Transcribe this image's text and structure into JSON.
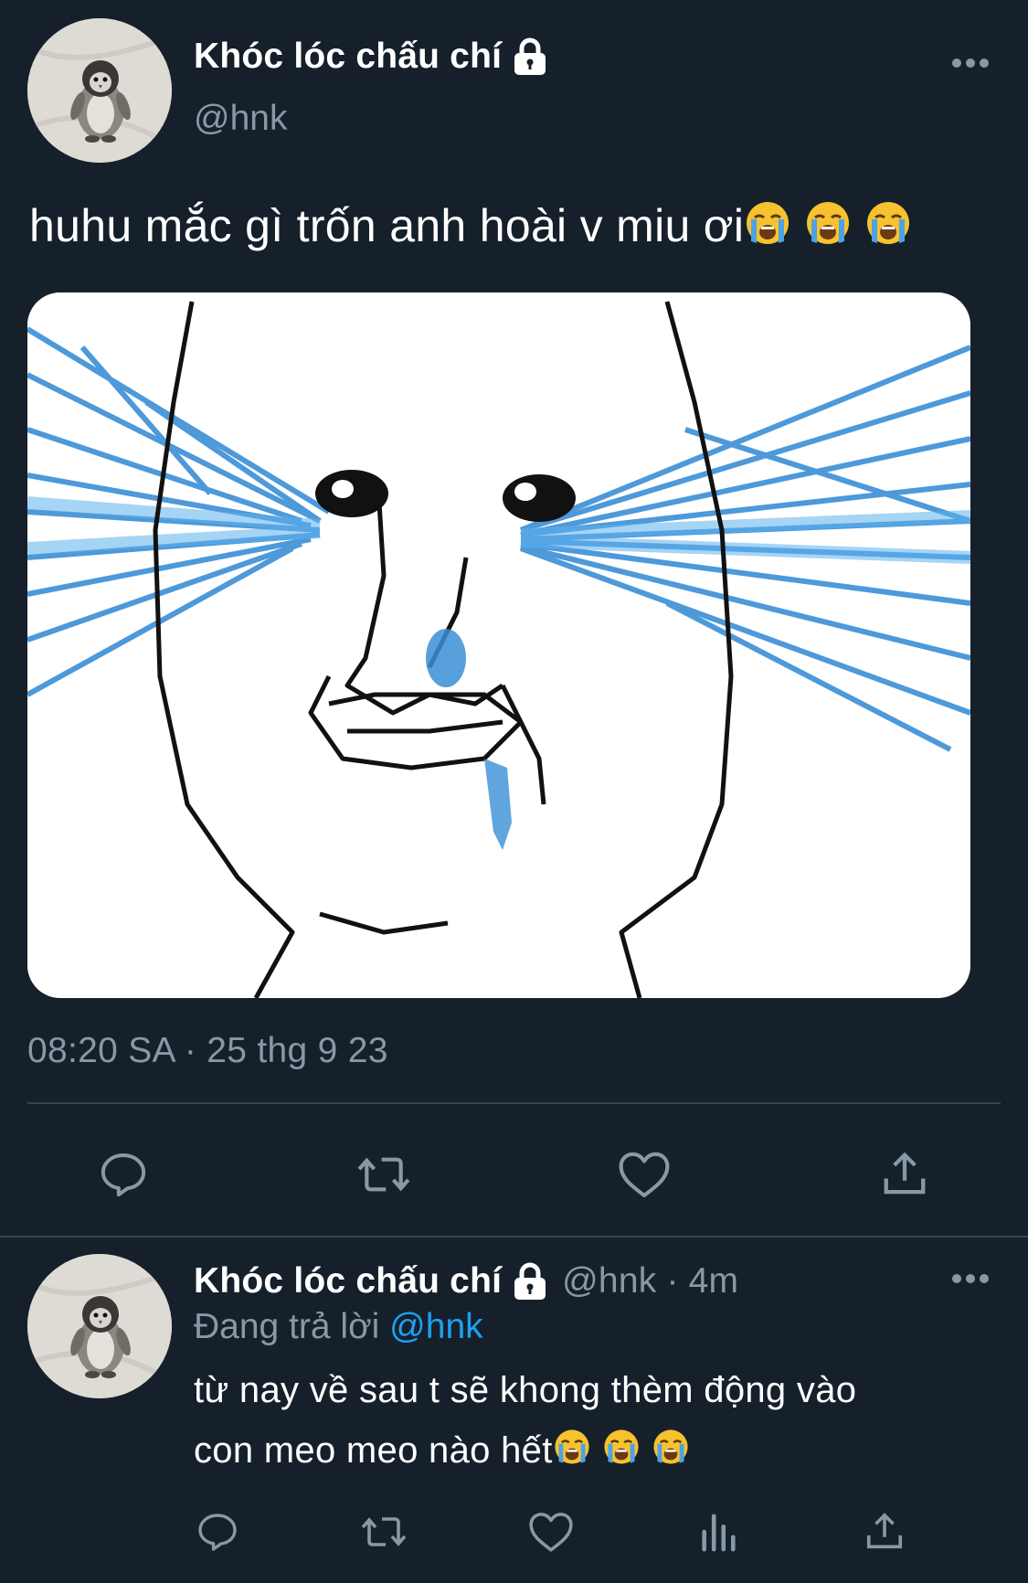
{
  "tweet": {
    "author_name": "Khóc lóc chấu chí",
    "handle": "@hnk",
    "text": "huhu mắc gì trốn anh hoài v miu ơi",
    "text_emojis": [
      "loudly-crying-face",
      "loudly-crying-face",
      "loudly-crying-face"
    ],
    "timestamp": "08:20 SA · 25 thg 9 23",
    "actions": [
      "reply",
      "retweet",
      "like",
      "share"
    ]
  },
  "reply": {
    "author_name": "Khóc lóc chấu chí",
    "handle_time": "@hnk · 4m",
    "replying_to_label": "Đang trả lời",
    "replying_to_handle": "@hnk",
    "line1": "từ nay về sau t sẽ khong thèm động vào",
    "line2": "con meo meo nào hết",
    "text_emojis": [
      "loudly-crying-face",
      "loudly-crying-face",
      "loudly-crying-face"
    ],
    "actions": [
      "reply",
      "retweet",
      "like",
      "analytics",
      "share"
    ]
  },
  "colors": {
    "background": "#15202b",
    "secondary_text": "#8899a6",
    "link": "#1da1f2",
    "divider": "#38444d",
    "tears": "#3a8fd6"
  }
}
